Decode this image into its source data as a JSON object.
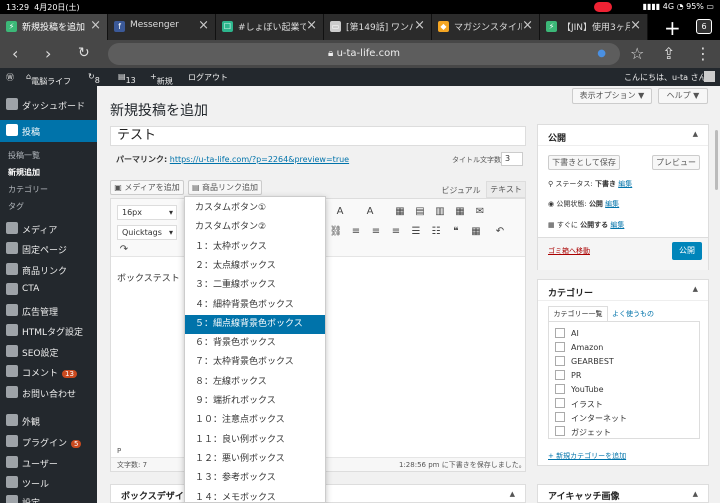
{
  "status": {
    "time": "13:29",
    "date": "4月20日(土)",
    "net": "4G",
    "battery": "95%"
  },
  "tabs": [
    {
      "title": "新規投稿を追加",
      "fav": "#3cb878",
      "glyph": "⚡",
      "active": true
    },
    {
      "title": "Messenger",
      "fav": "#3b5998",
      "glyph": "f"
    },
    {
      "title": "#しょぼい起業で",
      "fav": "#2db68d",
      "glyph": "☐"
    },
    {
      "title": "[第149話] ワンパ",
      "fav": "#ccc",
      "glyph": "▭"
    },
    {
      "title": "マガジンスタイル",
      "fav": "#f5a623",
      "glyph": "◆"
    },
    {
      "title": "【JIN】使用3ヶ月",
      "fav": "#3cb878",
      "glyph": "⚡"
    }
  ],
  "tab_count": "6",
  "url": "u-ta-life.com",
  "admin": {
    "site": "電脳ライフ",
    "updates": "8",
    "comments": "13",
    "new": "新規",
    "logout": "ログアウト",
    "greeting": "こんにちは、u-ta さん"
  },
  "menu": {
    "dashboard": "ダッシュボード",
    "posts": "投稿",
    "sub_list": "投稿一覧",
    "sub_new": "新規追加",
    "sub_cat": "カテゴリー",
    "sub_tag": "タグ",
    "media": "メディア",
    "pages": "固定ページ",
    "products": "商品リンク",
    "cta": "CTA",
    "ads": "広告管理",
    "htmltag": "HTMLタグ設定",
    "seo": "SEO設定",
    "comments": "コメント",
    "comments_badge": "13",
    "contact": "お問い合わせ",
    "appearance": "外観",
    "plugins": "プラグイン",
    "plugins_badge": "5",
    "users": "ユーザー",
    "tools": "ツール",
    "settings": "設定"
  },
  "screen_options": "表示オプション ▼",
  "help": "ヘルプ ▼",
  "page_title": "新規投稿を追加",
  "post_title": "テスト",
  "permalink_label": "パーマリンク:",
  "permalink_url": "https://u-ta-life.com/?p=2264&preview=true",
  "title_count_label": "タイトル文字数:",
  "title_count": "3",
  "add_media": "メディアを追加",
  "product_link": "商品リンク追加",
  "visual_tab": "ビジュアル",
  "text_tab": "テキスト",
  "font_size": "16px",
  "quicktags": "Quicktags",
  "editor_content": "ボックステスト",
  "path": "P",
  "word_count": "文字数: 7",
  "autosave": "1:28:56 pm に下書きを保存しました。",
  "box_design": "ボックスデザイン",
  "dropdown": [
    "カスタムボタン①",
    "カスタムボタン②",
    "１：太枠ボックス",
    "２：太点線ボックス",
    "３：二重線ボックス",
    "４：細枠背景色ボックス",
    "５：細点線背景色ボックス",
    "６：背景色ボックス",
    "７：太枠背景色ボックス",
    "８：左線ボックス",
    "９：端折れボックス",
    "１０：注意点ボックス",
    "１１：良い例ボックス",
    "１２：悪い例ボックス",
    "１３：参考ボックス",
    "１４：メモボックス"
  ],
  "dropdown_selected": 6,
  "publish": {
    "title": "公開",
    "save_draft": "下書きとして保存",
    "preview": "プレビュー",
    "status_label": "ステータス:",
    "status_value": "下書き",
    "visibility_label": "公開状態:",
    "visibility_value": "公開",
    "schedule_label": "すぐに",
    "schedule_value": "公開する",
    "edit": "編集",
    "trash": "ゴミ箱へ移動",
    "publish_btn": "公開"
  },
  "category": {
    "title": "カテゴリー",
    "tab_all": "カテゴリー一覧",
    "tab_popular": "よく使うもの",
    "items": [
      "AI",
      "Amazon",
      "GEARBEST",
      "PR",
      "YouTube",
      "イラスト",
      "インターネット",
      "ガジェット"
    ],
    "add_new": "+ 新規カテゴリーを追加"
  },
  "eyecatch": "アイキャッチ画像",
  "colors": {
    "wp_blue": "#0073aa",
    "admin_dark": "#23282d",
    "chrome_dark": "#474747"
  }
}
